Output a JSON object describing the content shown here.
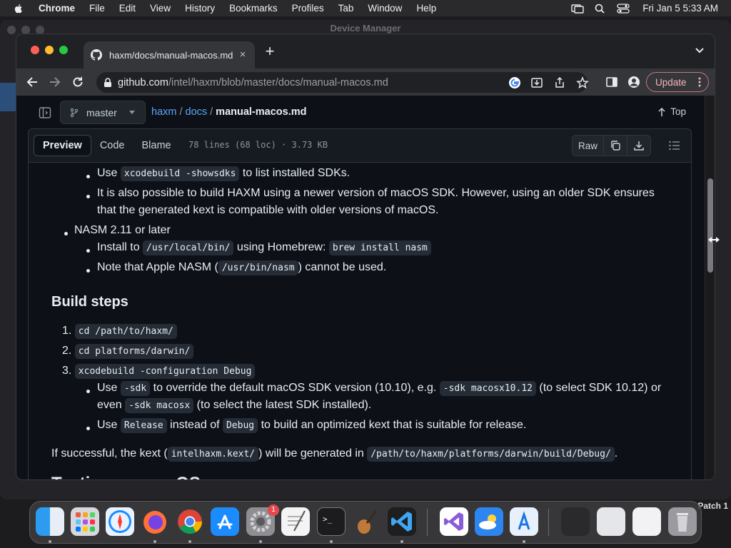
{
  "menubar": {
    "app": "Chrome",
    "items": [
      "File",
      "Edit",
      "View",
      "History",
      "Bookmarks",
      "Profiles",
      "Tab",
      "Window",
      "Help"
    ],
    "clock": "Fri Jan 5  5:33 AM"
  },
  "background_window": {
    "title": "Device Manager",
    "patch_label": "Patch 1"
  },
  "browser": {
    "tab_title": "haxm/docs/manual-macos.md",
    "url_host": "github.com",
    "url_path": "/intel/haxm/blob/master/docs/manual-macos.md",
    "update_label": "Update"
  },
  "github": {
    "branch": "master",
    "breadcrumb": {
      "repo": "haxm",
      "folder": "docs",
      "file": "manual-macos.md"
    },
    "top_label": "Top",
    "tabs": [
      "Preview",
      "Code",
      "Blame"
    ],
    "file_meta": "78 lines (68 loc) · 3.73 KB",
    "raw_label": "Raw"
  },
  "content": {
    "l1_pre": "Use ",
    "l1_code": "xcodebuild -showsdks",
    "l1_post": " to list installed SDKs.",
    "l2a": "It is also possible to build HAXM using a newer version of macOS SDK. However, using an older SDK ensures",
    "l2b": "that the generated kext is compatible with older versions of macOS.",
    "nasm": "NASM 2.11 or later",
    "n1_pre": "Install to ",
    "n1_code1": "/usr/local/bin/",
    "n1_mid": " using Homebrew: ",
    "n1_code2": "brew install nasm",
    "n2_pre": "Note that Apple NASM (",
    "n2_code": "/usr/bin/nasm",
    "n2_post": ") cannot be used.",
    "heading": "Build steps",
    "s1_num": "1.",
    "s1_code": "cd /path/to/haxm/",
    "s2_num": "2.",
    "s2_code": "cd platforms/darwin/",
    "s3_num": "3.",
    "s3_code": "xcodebuild -configuration Debug",
    "b1_pre": "Use ",
    "b1_code1": "-sdk",
    "b1_mid": " to override the default macOS SDK version (10.10), e.g. ",
    "b1_code2": "-sdk macosx10.12",
    "b1_post": " (to select SDK 10.12) or",
    "b1b_pre": "even ",
    "b1b_code": "-sdk macosx",
    "b1b_post": " (to select the latest SDK installed).",
    "b2_pre": "Use ",
    "b2_code1": "Release",
    "b2_mid": " instead of ",
    "b2_code2": "Debug",
    "b2_post": " to build an optimized kext that is suitable for release.",
    "f_pre": "If successful, the kext (",
    "f_code1": "intelhaxm.kext/",
    "f_mid": ") will be generated in ",
    "f_code2": "/path/to/haxm/platforms/darwin/build/Debug/",
    "f_post": ".",
    "next_heading": "Testing on macOS"
  },
  "dock": {
    "settings_badge": "1"
  },
  "colors": {
    "link": "#58a6ff",
    "page_bg": "#0d1117",
    "update_border": "#c3777c"
  }
}
